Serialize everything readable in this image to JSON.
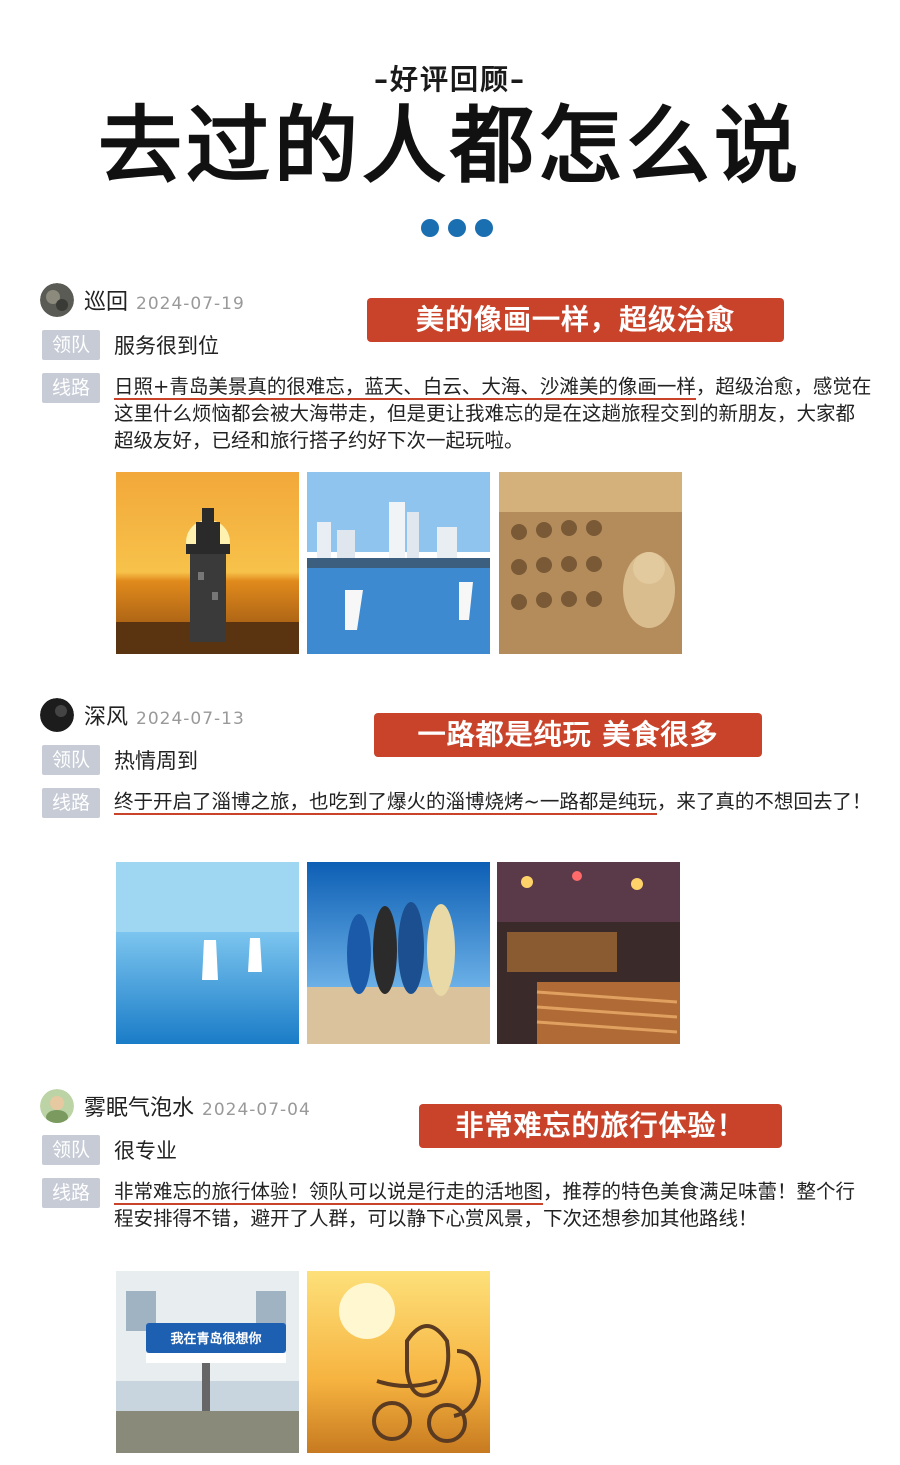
{
  "header": {
    "subtitle": "–好评回顾–",
    "title": "去过的人都怎么说"
  },
  "labels": {
    "leader": "领队",
    "route": "线路"
  },
  "reviews": [
    {
      "name": "巡回",
      "date": "2024-07-19",
      "tagline": "美的像画一样，超级治愈",
      "leader": "服务很到位",
      "route_underlined": "日照+青岛美景真的很难忘，蓝天、白云、大海、沙滩美的像画一样",
      "route_rest": "，超级治愈，感觉在这里什么烦恼都会被大海带走，但是更让我难忘的是在这趟旅程交到的新朋友，大家都超级友好，已经和旅行搭子约好下次一起玩啦。",
      "photos": [
        "lighthouse-sunset",
        "sailboats-city",
        "stone-buddha-carvings"
      ]
    },
    {
      "name": "深风",
      "date": "2024-07-13",
      "tagline": "一路都是纯玩 美食很多",
      "leader": "热情周到",
      "route_underlined": "终于开启了淄博之旅，也吃到了爆火的淄博烧烤~一路都是纯玩",
      "route_rest": "，来了真的不想回去了！",
      "photos": [
        "sailboats-sea",
        "surfboards-beach",
        "bbq-street-food"
      ]
    },
    {
      "name": "雾眠气泡水",
      "date": "2024-07-04",
      "tagline": "非常难忘的旅行体验！",
      "leader": "很专业",
      "route_underlined": "非常难忘的旅行体验！领队可以说是行走的活地图",
      "route_rest": "，推荐的特色美食满足味蕾！整个行程安排得不错，避开了人群，可以静下心赏风景，下次还想参加其他路线！",
      "photos": [
        "qingdao-street-sign",
        "couple-sculpture-sunset"
      ],
      "sign_text": "我在青岛很想你"
    }
  ],
  "colors": {
    "accent": "#c8432a",
    "label_bg": "#c7cbd6",
    "dot": "#1a6fb0"
  }
}
